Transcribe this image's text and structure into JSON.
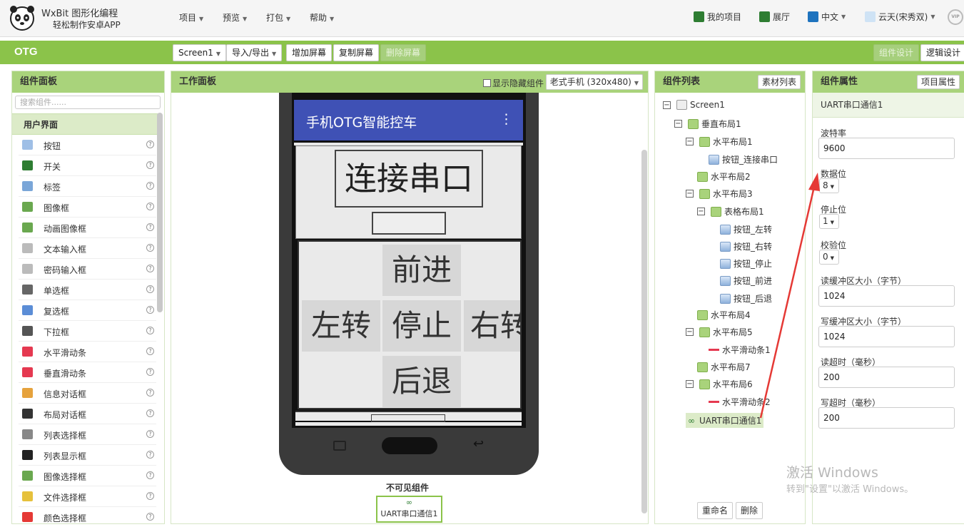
{
  "header": {
    "brand_title": "WxBit 图形化编程",
    "brand_subtitle": "轻松制作安卓APP",
    "menus": [
      "项目",
      "预览",
      "打包",
      "帮助"
    ],
    "my_projects": "我的项目",
    "gallery": "展厅",
    "language": "中文",
    "user": "云天(宋秀双)",
    "vip_badge": "VIP"
  },
  "toolbar": {
    "project_name": "OTG",
    "screen_select": "Screen1",
    "import_export": "导入/导出",
    "add_screen": "增加屏幕",
    "copy_screen": "复制屏幕",
    "delete_screen": "删除屏幕",
    "component_design": "组件设计",
    "logic_design": "逻辑设计"
  },
  "palette": {
    "title": "组件面板",
    "search_placeholder": "搜索组件......",
    "category": "用户界面",
    "items": [
      {
        "label": "按钮",
        "icon": "button-icon"
      },
      {
        "label": "开关",
        "icon": "switch-icon"
      },
      {
        "label": "标签",
        "icon": "label-icon"
      },
      {
        "label": "图像框",
        "icon": "image-icon"
      },
      {
        "label": "动画图像框",
        "icon": "animated-image-icon"
      },
      {
        "label": "文本输入框",
        "icon": "textbox-icon"
      },
      {
        "label": "密码输入框",
        "icon": "password-icon"
      },
      {
        "label": "单选框",
        "icon": "radio-icon"
      },
      {
        "label": "复选框",
        "icon": "checkbox-icon"
      },
      {
        "label": "下拉框",
        "icon": "spinner-icon"
      },
      {
        "label": "水平滑动条",
        "icon": "hslider-icon"
      },
      {
        "label": "垂直滑动条",
        "icon": "vslider-icon"
      },
      {
        "label": "信息对话框",
        "icon": "warning-icon"
      },
      {
        "label": "布局对话框",
        "icon": "dialog-icon"
      },
      {
        "label": "列表选择框",
        "icon": "listpicker-icon"
      },
      {
        "label": "列表显示框",
        "icon": "listview-icon"
      },
      {
        "label": "图像选择框",
        "icon": "imagepicker-icon"
      },
      {
        "label": "文件选择框",
        "icon": "filepicker-icon"
      },
      {
        "label": "颜色选择框",
        "icon": "colorpicker-icon"
      }
    ]
  },
  "workspace": {
    "title": "工作面板",
    "show_hidden": "显示隐藏组件",
    "device": "老式手机 (320x480)",
    "app_title": "手机OTG智能控车",
    "connect_button": "连接串口",
    "forward": "前进",
    "left": "左转",
    "stop": "停止",
    "right": "右转",
    "back": "后退",
    "invisible_title": "不可见组件",
    "invisible_item": "UART串口通信1"
  },
  "tree": {
    "title": "组件列表",
    "media_button": "素材列表",
    "nodes": [
      {
        "label": "Screen1",
        "toggle": "⊟",
        "icon": "screen"
      },
      {
        "label": "垂直布局1",
        "toggle": "⊟",
        "icon": "layout"
      },
      {
        "label": "水平布局1",
        "toggle": "⊟",
        "icon": "layout"
      },
      {
        "label": "按钮_连接串口",
        "toggle": "",
        "icon": "button"
      },
      {
        "label": "水平布局2",
        "toggle": "",
        "icon": "layout"
      },
      {
        "label": "水平布局3",
        "toggle": "⊟",
        "icon": "layout"
      },
      {
        "label": "表格布局1",
        "toggle": "⊟",
        "icon": "layout"
      },
      {
        "label": "按钮_左转",
        "toggle": "",
        "icon": "button"
      },
      {
        "label": "按钮_右转",
        "toggle": "",
        "icon": "button"
      },
      {
        "label": "按钮_停止",
        "toggle": "",
        "icon": "button"
      },
      {
        "label": "按钮_前进",
        "toggle": "",
        "icon": "button"
      },
      {
        "label": "按钮_后退",
        "toggle": "",
        "icon": "button"
      },
      {
        "label": "水平布局4",
        "toggle": "",
        "icon": "layout"
      },
      {
        "label": "水平布局5",
        "toggle": "⊟",
        "icon": "layout"
      },
      {
        "label": "水平滑动条1",
        "toggle": "",
        "icon": "slider"
      },
      {
        "label": "水平布局7",
        "toggle": "",
        "icon": "layout"
      },
      {
        "label": "水平布局6",
        "toggle": "⊟",
        "icon": "layout"
      },
      {
        "label": "水平滑动条2",
        "toggle": "",
        "icon": "slider"
      },
      {
        "label": "UART串口通信1",
        "toggle": "",
        "icon": "uart"
      }
    ],
    "rename": "重命名",
    "delete": "删除"
  },
  "properties": {
    "title": "组件属性",
    "project_props": "项目属性",
    "component_name": "UART串口通信1",
    "baud_label": "波特率",
    "baud_value": "9600",
    "databits_label": "数据位",
    "databits_value": "8",
    "stopbits_label": "停止位",
    "stopbits_value": "1",
    "parity_label": "校验位",
    "parity_value": "0",
    "readbuf_label": "读缓冲区大小（字节）",
    "readbuf_value": "1024",
    "writebuf_label": "写缓冲区大小（字节）",
    "writebuf_value": "1024",
    "readtimeout_label": "读超时（毫秒）",
    "readtimeout_value": "200",
    "writetimeout_label": "写超时（毫秒）",
    "writetimeout_value": "200"
  },
  "watermark": {
    "line1": "激活 Windows",
    "line2": "转到\"设置\"以激活 Windows。"
  },
  "colors": {
    "toolbar_green": "#8bc34a",
    "panel_head_green": "#a9d37b",
    "appbar_blue": "#3f51b5",
    "arrow_red": "#e53935"
  }
}
